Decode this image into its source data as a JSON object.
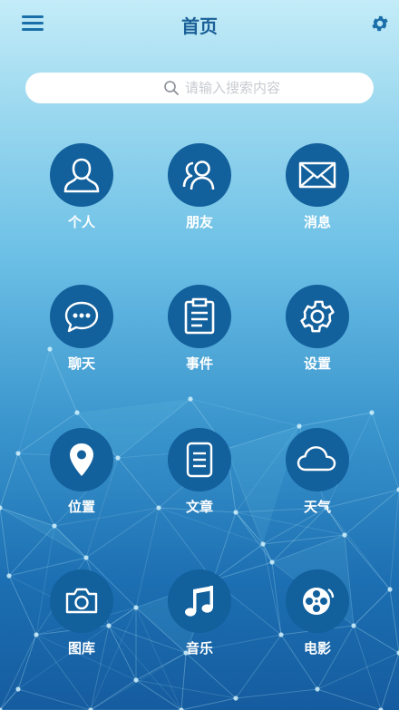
{
  "header": {
    "title": "首页",
    "menu_icon": "hamburger-menu-icon",
    "settings_icon": "gear-icon"
  },
  "search": {
    "placeholder": "请输入搜索内容",
    "value": ""
  },
  "grid": [
    {
      "key": "person",
      "label": "个人",
      "icon": "person-icon"
    },
    {
      "key": "friends",
      "label": "朋友",
      "icon": "friends-icon"
    },
    {
      "key": "messages",
      "label": "消息",
      "icon": "envelope-icon"
    },
    {
      "key": "chat",
      "label": "聊天",
      "icon": "chat-bubble-icon"
    },
    {
      "key": "events",
      "label": "事件",
      "icon": "clipboard-icon"
    },
    {
      "key": "settings",
      "label": "设置",
      "icon": "gear-icon"
    },
    {
      "key": "location",
      "label": "位置",
      "icon": "location-pin-icon"
    },
    {
      "key": "article",
      "label": "文章",
      "icon": "document-icon"
    },
    {
      "key": "weather",
      "label": "天气",
      "icon": "cloud-icon"
    },
    {
      "key": "gallery",
      "label": "图库",
      "icon": "camera-icon"
    },
    {
      "key": "music",
      "label": "音乐",
      "icon": "music-note-icon"
    },
    {
      "key": "movie",
      "label": "电影",
      "icon": "film-reel-icon"
    }
  ],
  "colors": {
    "header_accent": "#1a5f97",
    "icon_circle": "#12609c",
    "label": "#ffffff"
  }
}
